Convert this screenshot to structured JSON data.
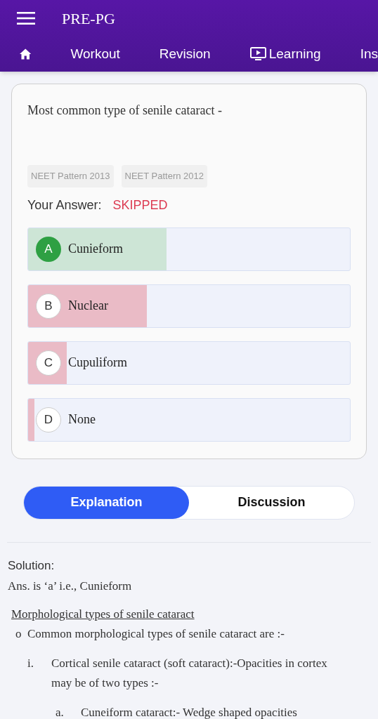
{
  "app_bar": {
    "title": "PRE-PG"
  },
  "nav_tabs": [
    {
      "label": "Workout",
      "kind": "text"
    },
    {
      "label": "Revision",
      "kind": "text"
    },
    {
      "label": "Learning",
      "kind": "video"
    },
    {
      "label": "Ins",
      "kind": "text"
    }
  ],
  "question": {
    "text": "Most common type of senile cataract -",
    "tags": [
      "NEET Pattern 2013",
      "NEET Pattern 2012"
    ],
    "answer_label": "Your Answer:",
    "answer_value": "SKIPPED"
  },
  "options": [
    {
      "letter": "A",
      "text": "Cunieform",
      "correct": true,
      "level": 0.43
    },
    {
      "letter": "B",
      "text": "Nuclear",
      "correct": false,
      "level": 0.37
    },
    {
      "letter": "C",
      "text": "Cupuliform",
      "correct": false,
      "level": 0.12
    },
    {
      "letter": "D",
      "text": "None",
      "correct": false,
      "level": 0.02
    }
  ],
  "toggle": [
    {
      "label": "Explanation",
      "selected": true
    },
    {
      "label": "Discussion",
      "selected": false
    }
  ],
  "solution": {
    "heading": "Solution:",
    "answer": "Ans. is ‘a’ i.e., Cunieform",
    "subheading": "Morphological types of senile cataract",
    "lines": [
      {
        "kind": "bullet",
        "marker": "o",
        "text": "Common morphological types of senile cataract are :-"
      },
      {
        "kind": "roman",
        "marker": "i.",
        "text": "Cortical senile cataract (soft cataract):-Opacities in cortex may be of two types :-"
      },
      {
        "kind": "alpha",
        "marker": "a.",
        "text": "Cuneiform cataract:- Wedge shaped opacities"
      }
    ]
  }
}
